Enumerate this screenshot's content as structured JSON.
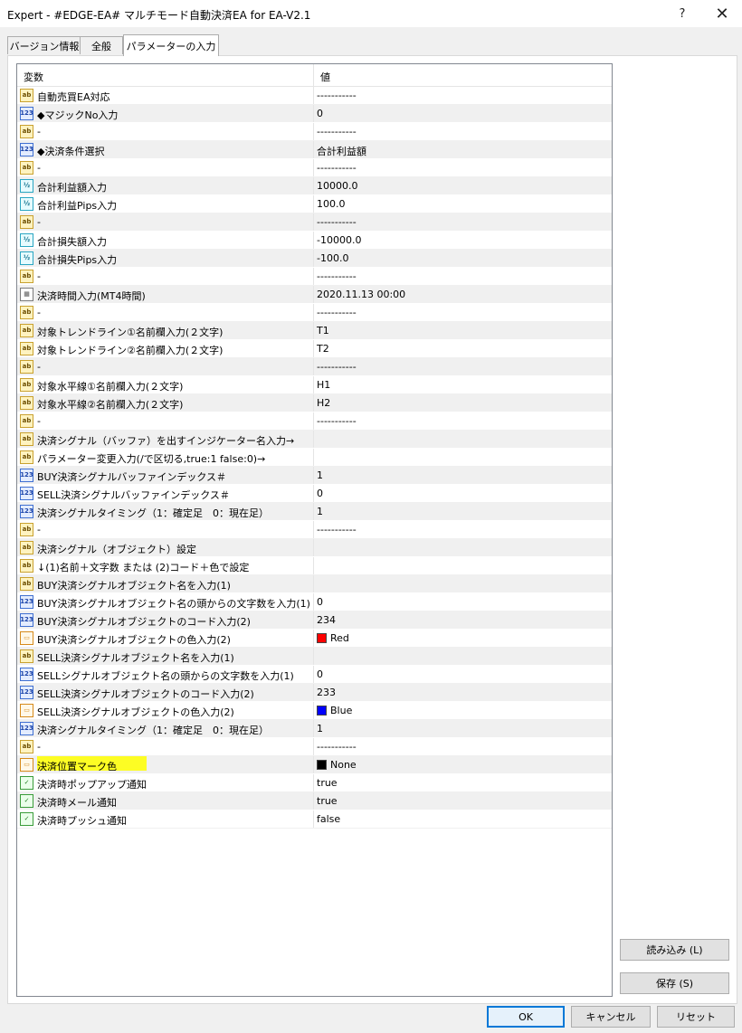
{
  "window": {
    "title": "Expert - #EDGE-EA# マルチモード自動決済EA for EA-V2.1",
    "help_glyph": "?",
    "close_glyph": "✕"
  },
  "tabs": [
    {
      "label": "バージョン情報",
      "active": false
    },
    {
      "label": "全般",
      "active": false
    },
    {
      "label": "パラメーターの入力",
      "active": true
    }
  ],
  "grid": {
    "col_variable": "変数",
    "col_value": "値",
    "rows": [
      {
        "type": "string",
        "name": "自動売買EA対応",
        "value": "-----------"
      },
      {
        "type": "integer",
        "name": "◆マジックNo入力",
        "value": "0"
      },
      {
        "type": "string",
        "name": "-",
        "value": "-----------"
      },
      {
        "type": "integer",
        "name": "◆決済条件選択",
        "value": "合計利益額"
      },
      {
        "type": "string",
        "name": "-",
        "value": "-----------"
      },
      {
        "type": "double",
        "name": "合計利益額入力",
        "value": "10000.0"
      },
      {
        "type": "double",
        "name": "合計利益Pips入力",
        "value": "100.0"
      },
      {
        "type": "string",
        "name": "-",
        "value": "-----------"
      },
      {
        "type": "double",
        "name": "合計損失額入力",
        "value": "-10000.0"
      },
      {
        "type": "double",
        "name": "合計損失Pips入力",
        "value": "-100.0"
      },
      {
        "type": "string",
        "name": "-",
        "value": "-----------"
      },
      {
        "type": "datetime",
        "name": "決済時間入力(MT4時間)",
        "value": "2020.11.13 00:00"
      },
      {
        "type": "string",
        "name": "-",
        "value": "-----------"
      },
      {
        "type": "string",
        "name": "対象トレンドライン①名前欄入力(２文字)",
        "value": "T1"
      },
      {
        "type": "string",
        "name": "対象トレンドライン②名前欄入力(２文字)",
        "value": "T2"
      },
      {
        "type": "string",
        "name": "-",
        "value": "-----------"
      },
      {
        "type": "string",
        "name": "対象水平線①名前欄入力(２文字)",
        "value": "H1"
      },
      {
        "type": "string",
        "name": "対象水平線②名前欄入力(２文字)",
        "value": "H2"
      },
      {
        "type": "string",
        "name": "-",
        "value": "-----------"
      },
      {
        "type": "string",
        "name": "決済シグナル（バッファ）を出すインジケーター名入力→",
        "value": ""
      },
      {
        "type": "string",
        "name": "パラメーター変更入力(/で区切る,true:1 false:0)→",
        "value": ""
      },
      {
        "type": "integer",
        "name": "BUY決済シグナルバッファインデックス＃",
        "value": "1"
      },
      {
        "type": "integer",
        "name": "SELL決済シグナルバッファインデックス＃",
        "value": "0"
      },
      {
        "type": "integer",
        "name": "決済シグナルタイミング（1：確定足　0：現在足）",
        "value": "1"
      },
      {
        "type": "string",
        "name": "-",
        "value": "-----------"
      },
      {
        "type": "string",
        "name": "決済シグナル（オブジェクト）設定",
        "value": ""
      },
      {
        "type": "string",
        "name": "↓(1)名前＋文字数 または (2)コード＋色で設定",
        "value": ""
      },
      {
        "type": "string",
        "name": "BUY決済シグナルオブジェクト名を入力(1)",
        "value": ""
      },
      {
        "type": "integer",
        "name": "BUY決済シグナルオブジェクト名の頭からの文字数を入力(1)",
        "value": "0"
      },
      {
        "type": "integer",
        "name": "BUY決済シグナルオブジェクトのコード入力(2)",
        "value": "234"
      },
      {
        "type": "color",
        "name": "BUY決済シグナルオブジェクトの色入力(2)",
        "value": "Red",
        "swatch": "#ff0000"
      },
      {
        "type": "string",
        "name": "SELL決済シグナルオブジェクト名を入力(1)",
        "value": ""
      },
      {
        "type": "integer",
        "name": "SELLシグナルオブジェクト名の頭からの文字数を入力(1)",
        "value": "0"
      },
      {
        "type": "integer",
        "name": "SELL決済シグナルオブジェクトのコード入力(2)",
        "value": "233"
      },
      {
        "type": "color",
        "name": "SELL決済シグナルオブジェクトの色入力(2)",
        "value": "Blue",
        "swatch": "#0000ff"
      },
      {
        "type": "integer",
        "name": "決済シグナルタイミング（1：確定足　0：現在足）",
        "value": "1"
      },
      {
        "type": "string",
        "name": "-",
        "value": "-----------"
      },
      {
        "type": "color",
        "name": "決済位置マーク色",
        "value": "None",
        "swatch": "#000000",
        "highlight": true
      },
      {
        "type": "bool",
        "name": "決済時ポップアップ通知",
        "value": "true"
      },
      {
        "type": "bool",
        "name": "決済時メール通知",
        "value": "true"
      },
      {
        "type": "bool",
        "name": "決済時プッシュ通知",
        "value": "false"
      }
    ]
  },
  "type_icons": {
    "string": {
      "glyph": "ab",
      "icon": "string-type-icon"
    },
    "integer": {
      "glyph": "123",
      "icon": "integer-type-icon"
    },
    "double": {
      "glyph": "½",
      "icon": "double-type-icon"
    },
    "datetime": {
      "glyph": "▦",
      "icon": "datetime-type-icon"
    },
    "color": {
      "glyph": "▭",
      "icon": "color-type-icon"
    },
    "bool": {
      "glyph": "✓",
      "icon": "bool-type-icon"
    }
  },
  "buttons": {
    "load": "読み込み (L)",
    "save": "保存 (S)",
    "ok": "OK",
    "cancel": "キャンセル",
    "reset": "リセット"
  }
}
